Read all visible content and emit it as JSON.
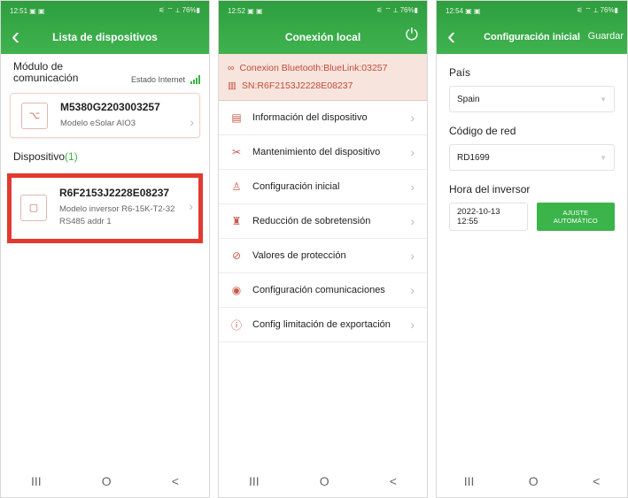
{
  "panel1": {
    "status": {
      "time": "12:51",
      "icons_left": "▣ ▣",
      "right": "⚟ ⌔ ⟂ 76%▮"
    },
    "title": "Lista de dispositivos",
    "module_title": "Módulo de comunicación",
    "internet_status": "Estado Internet",
    "module_card": {
      "title": "M5380G2203003257",
      "line1": "Modelo eSolar AIO3"
    },
    "device_label": "Dispositivo",
    "device_count": "(1)",
    "device_card": {
      "title": "R6F2153J2228E08237",
      "line1": "Modelo inversor  R6-15K-T2-32",
      "line2": "RS485 addr  1"
    }
  },
  "panel2": {
    "status": {
      "time": "12:52",
      "icons_left": "▣ ▣",
      "right": "⚟ ⌔ ⟂ 76%▮"
    },
    "title": "Conexión local",
    "bt_line": "Conexion Bluetooth:BlueLink:03257",
    "sn_line": "SN:R6F2153J2228E08237",
    "menu": [
      {
        "label": "Información del dispositivo",
        "icon": "document-icon"
      },
      {
        "label": "Mantenimiento del dispositivo",
        "icon": "tools-icon"
      },
      {
        "label": "Configuración inicial",
        "icon": "setup-icon"
      },
      {
        "label": "Reducción de sobretensión",
        "icon": "surge-icon"
      },
      {
        "label": "Valores de protección",
        "icon": "protection-icon"
      },
      {
        "label": "Configuración comunicaciones",
        "icon": "antenna-icon"
      },
      {
        "label": "Config limitación de exportación",
        "icon": "export-limit-icon"
      }
    ]
  },
  "panel3": {
    "status": {
      "time": "12:54",
      "icons_left": "▣ ▣",
      "right": "⚟ ⌔ ⟂ 76%▮"
    },
    "title": "Configuración inicial",
    "save": "Guardar",
    "country_label": "País",
    "country_value": "Spain",
    "grid_label": "Código de red",
    "grid_value": "RD1699",
    "time_label": "Hora del inversor",
    "time_value": "2022-10-13 12:55",
    "auto_btn": "AJUSTE AUTOMÁTICO"
  },
  "nav": {
    "recents": "III",
    "home": "O",
    "back": "<"
  },
  "colors": {
    "accent_green": "#3bb44a",
    "highlight_red": "#e23a30",
    "bt_text": "#c64a3a"
  }
}
